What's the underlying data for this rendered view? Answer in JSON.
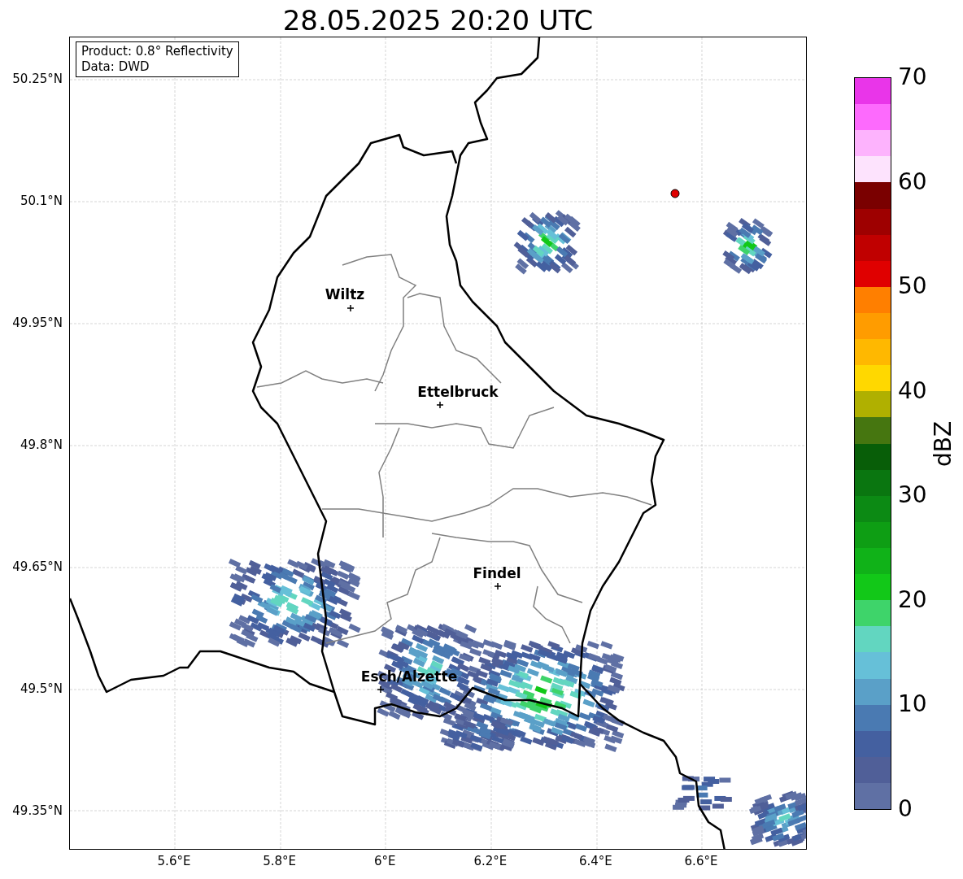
{
  "title": "28.05.2025 20:20 UTC",
  "info_box": {
    "lines": [
      "Product: 0.8° Reflectivity",
      "Data: DWD"
    ]
  },
  "map": {
    "cities": [
      {
        "name": "Wiltz"
      },
      {
        "name": "Ettelbruck"
      },
      {
        "name": "Findel"
      },
      {
        "name": "Esch/Alzette"
      }
    ],
    "lat_ticks": [
      "50.25°N",
      "50.1°N",
      "49.95°N",
      "49.8°N",
      "49.65°N",
      "49.5°N",
      "49.35°N"
    ],
    "lon_ticks": [
      "5.6°E",
      "5.8°E",
      "6°E",
      "6.2°E",
      "6.4°E",
      "6.6°E"
    ]
  },
  "colorbar": {
    "label": "dBZ",
    "ticks": [
      "70",
      "60",
      "50",
      "40",
      "30",
      "20",
      "10",
      "0"
    ],
    "bins": [
      {
        "color": "#e935e9"
      },
      {
        "color": "#fd6afd"
      },
      {
        "color": "#fdb3fd"
      },
      {
        "color": "#fde3fd"
      },
      {
        "color": "#7a0000"
      },
      {
        "color": "#9e0000"
      },
      {
        "color": "#c00000"
      },
      {
        "color": "#e00000"
      },
      {
        "color": "#ff7f00"
      },
      {
        "color": "#ff9c00"
      },
      {
        "color": "#ffb800"
      },
      {
        "color": "#ffd800"
      },
      {
        "color": "#b0b000"
      },
      {
        "color": "#467610"
      },
      {
        "color": "#085e08"
      },
      {
        "color": "#0a7610"
      },
      {
        "color": "#0c8a14"
      },
      {
        "color": "#0e9e14"
      },
      {
        "color": "#10b218"
      },
      {
        "color": "#12c818"
      },
      {
        "color": "#3ed46a"
      },
      {
        "color": "#62d6c0"
      },
      {
        "color": "#66c0d8"
      },
      {
        "color": "#5aa0c8"
      },
      {
        "color": "#4a7ab2"
      },
      {
        "color": "#4460a0"
      },
      {
        "color": "#505f98"
      },
      {
        "color": "#5f70a4"
      }
    ]
  }
}
